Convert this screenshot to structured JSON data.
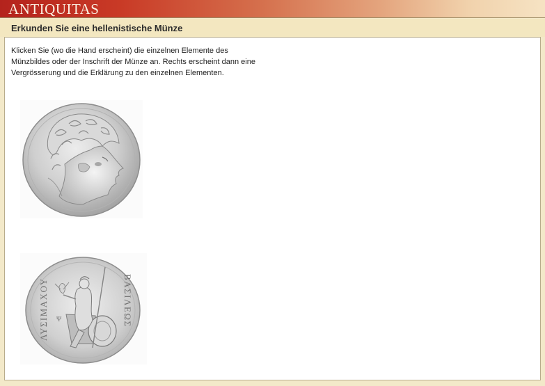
{
  "brand": {
    "logo_text": "ANTIQUITAS"
  },
  "header": {
    "title": "Erkunden Sie eine hellenistische Münze"
  },
  "main": {
    "instruction": "Klicken Sie (wo die Hand erscheint) die einzelnen Elemente des Münzbildes oder der Inschrift der Münze an. Rechts  erscheint dann eine Vergrösserung und die Erklärung zu den einzelnen Elementen."
  },
  "coins": {
    "obverse_icon": "coin-head-portrait",
    "reverse_icon": "coin-seated-athena",
    "reverse_inscription_right": "ΒΑΣΙΛΕΩΣ",
    "reverse_inscription_left": "ΛΥΣΙΜΑΧΟΥ"
  },
  "colors": {
    "banner_start": "#b4231d",
    "banner_end": "#f6e3c3",
    "header_bg": "#f3e7c0",
    "panel_bg": "#ffffff",
    "coin_silver": "#c9c9c9"
  }
}
